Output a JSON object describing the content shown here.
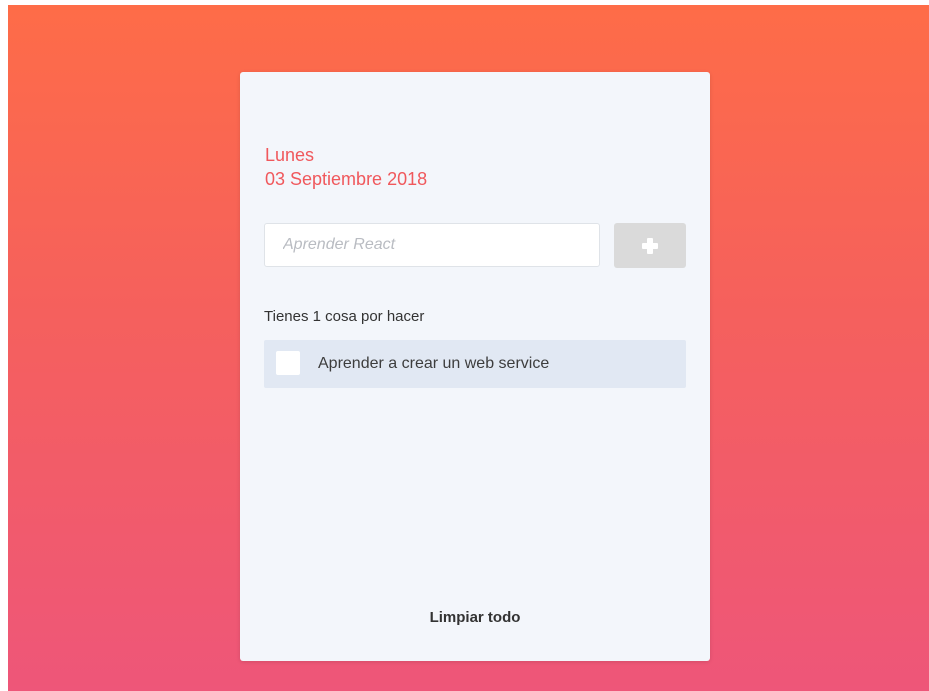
{
  "header": {
    "day": "Lunes",
    "date": "03 Septiembre 2018"
  },
  "new_todo": {
    "placeholder": "Aprender React",
    "value": "",
    "add_icon": "plus-icon"
  },
  "summary": {
    "pending_text": "Tienes 1 cosa por hacer"
  },
  "todos": [
    {
      "text": "Aprender a crear un web service",
      "done": false
    }
  ],
  "footer": {
    "clear_label": "Limpiar todo"
  },
  "colors": {
    "accent": "#f0585c",
    "background_top": "#fe6c48",
    "background_bottom": "#ee5679",
    "card": "#f3f6fb",
    "todo_item": "#e1e8f3",
    "add_button": "#dadada"
  }
}
